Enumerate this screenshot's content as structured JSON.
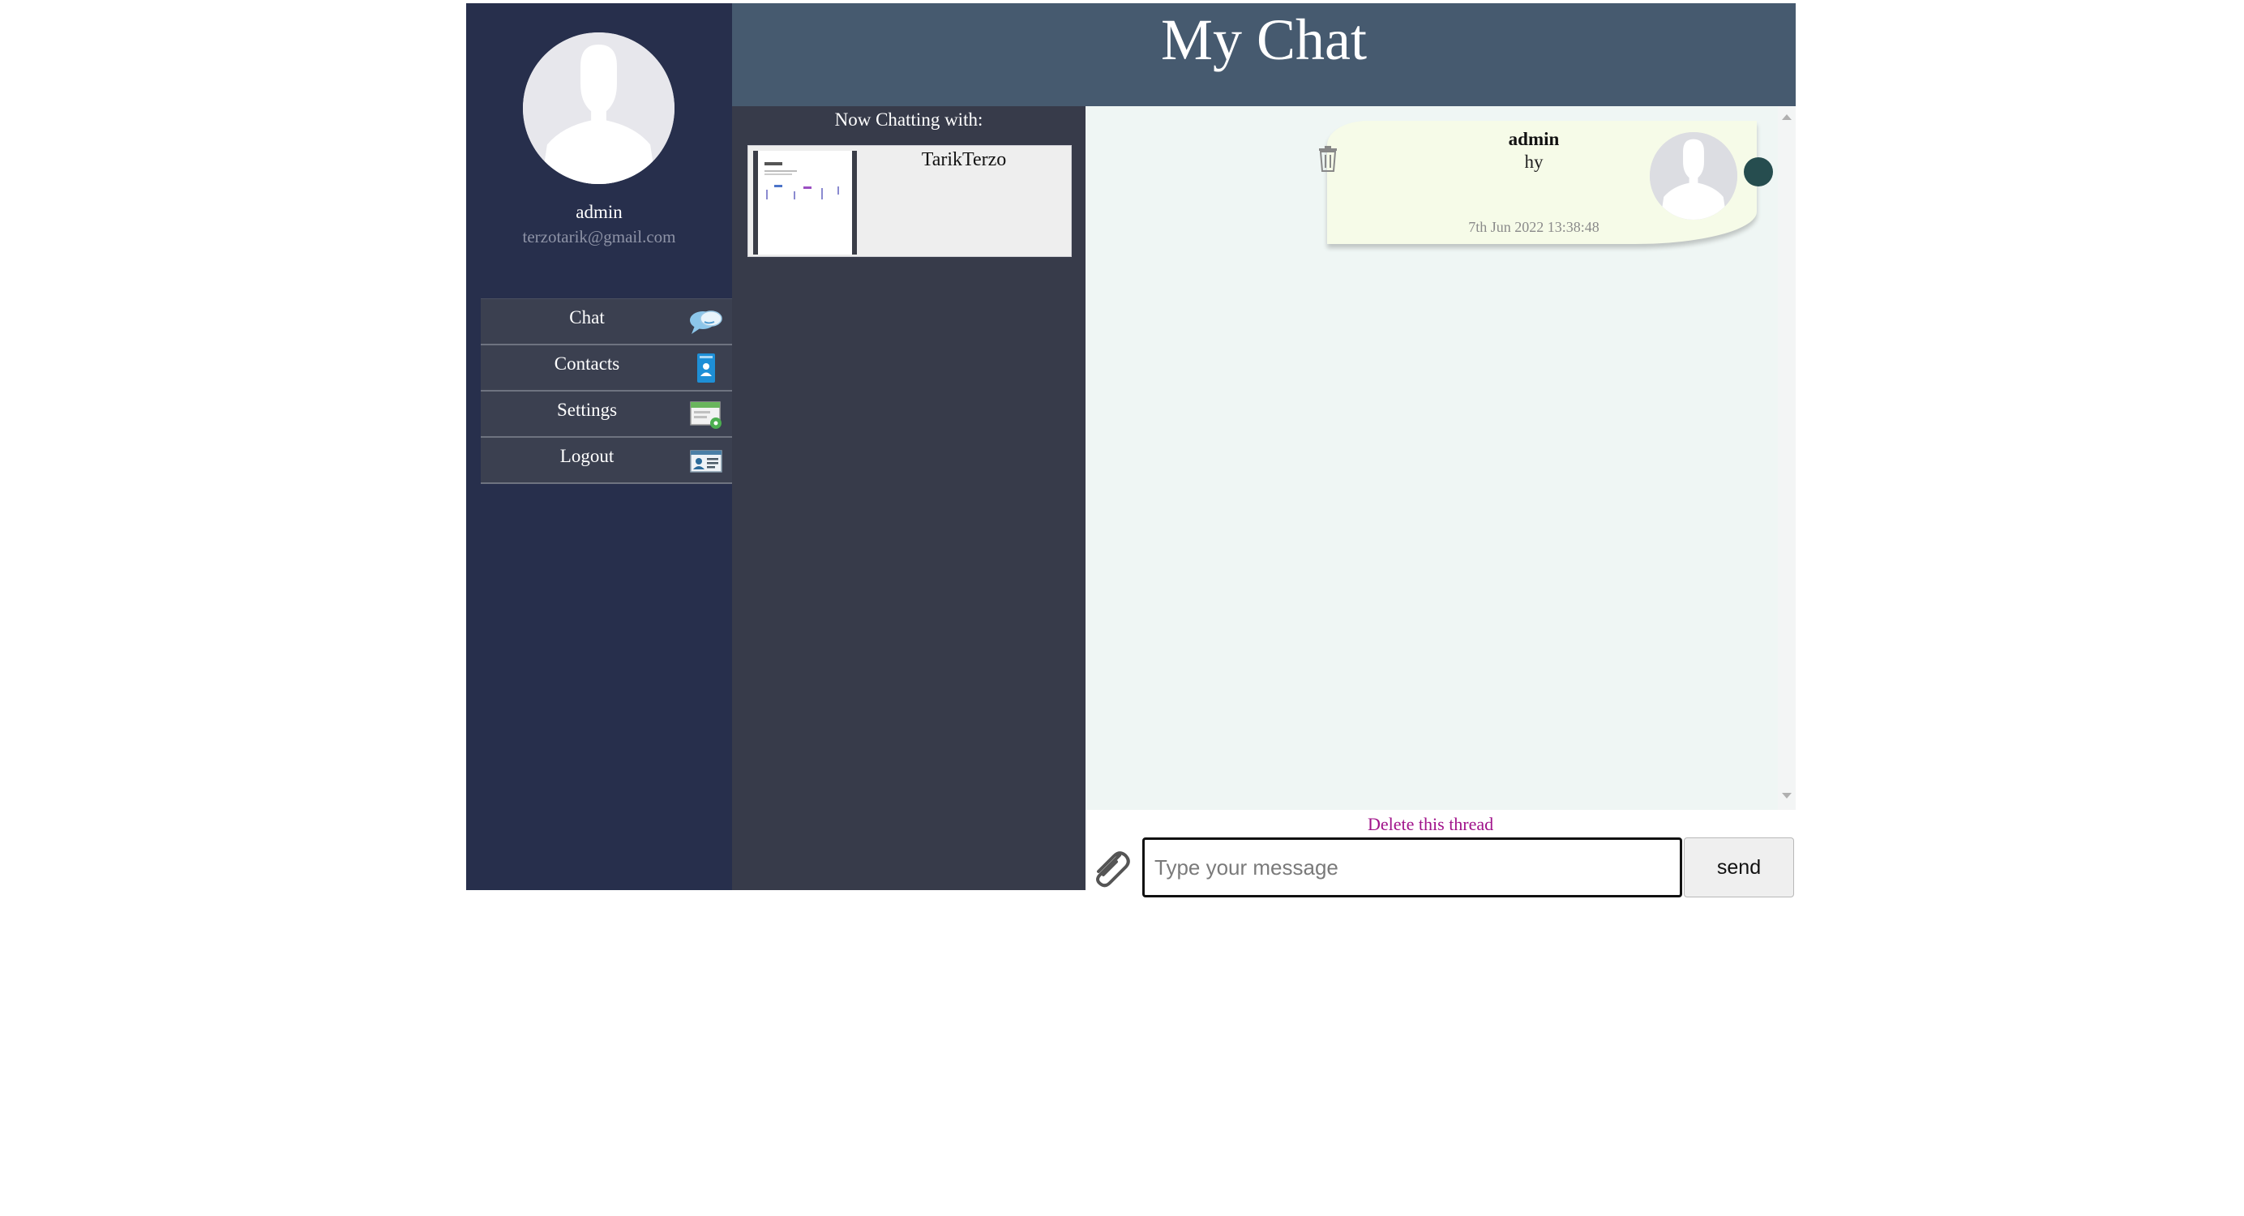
{
  "app": {
    "title": "My Chat"
  },
  "profile": {
    "name": "admin",
    "email": "terzotarik@gmail.com"
  },
  "menu": [
    {
      "label": "Chat",
      "icon": "chat-bubbles-icon"
    },
    {
      "label": "Contacts",
      "icon": "contact-card-icon"
    },
    {
      "label": "Settings",
      "icon": "settings-window-icon"
    },
    {
      "label": "Logout",
      "icon": "id-card-icon"
    }
  ],
  "contacts": {
    "heading": "Now Chatting with:",
    "items": [
      {
        "name": "TarikTerzo",
        "thumbnail": "screenshot-thumbnail"
      }
    ]
  },
  "messages": [
    {
      "author": "admin",
      "text": "hy",
      "time": "7th Jun 2022 13:38:48",
      "status_color": "#264d4f"
    }
  ],
  "thread": {
    "delete_label": "Delete this thread"
  },
  "composer": {
    "placeholder": "Type your message",
    "send_label": "send",
    "attach_icon": "paperclip-icon"
  },
  "colors": {
    "sidebar": "#272f4c",
    "header": "#465a6f",
    "contacts_panel": "#373b4a",
    "messages_panel": "#eff6f4",
    "bubble": "#f6fbe8",
    "delete_link": "#a0128a"
  }
}
